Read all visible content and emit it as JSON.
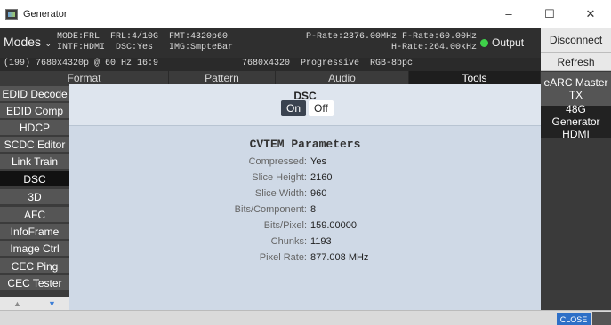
{
  "window": {
    "title": "Generator",
    "minimize": "–",
    "maximize": "☐",
    "close": "✕"
  },
  "status": {
    "modes_label": "Modes",
    "line1_left": "MODE:FRL  FRL:4/10G  FMT:4320p60",
    "line2_left": "INTF:HDMI  DSC:Yes   IMG:SmpteBar",
    "line1_right": "P-Rate:2376.00MHz F-Rate:60.00Hz",
    "line2_right": "H-Rate:264.00kHz",
    "line3_left": "(199) 7680x4320p @ 60 Hz 16:9",
    "line3_right": "7680x4320  Progressive  RGB-8bpc",
    "output_label": "Output",
    "output_color": "#3fd24a"
  },
  "right_buttons": {
    "disconnect": "Disconnect",
    "refresh": "Refresh",
    "earc": "eARC Master TX",
    "generator48": "48G Generator HDMI"
  },
  "tabs": [
    "Format",
    "Pattern",
    "Audio",
    "Tools"
  ],
  "active_tab": "Tools",
  "left_menu": [
    "EDID Decode",
    "EDID Comp",
    "HDCP",
    "SCDC Editor",
    "Link Train",
    "DSC",
    "3D",
    "AFC",
    "InfoFrame",
    "Image Ctrl",
    "CEC Ping",
    "CEC Tester"
  ],
  "left_menu_active": "DSC",
  "dsc": {
    "title": "DSC",
    "on_label": "On",
    "off_label": "Off"
  },
  "params": {
    "title": "CVTEM Parameters",
    "rows": [
      {
        "label": "Compressed:",
        "value": "Yes"
      },
      {
        "label": "Slice Height:",
        "value": "2160"
      },
      {
        "label": "Slice Width:",
        "value": "960"
      },
      {
        "label": "Bits/Component:",
        "value": "8"
      },
      {
        "label": "Bits/Pixel:",
        "value": "159.00000"
      },
      {
        "label": "Chunks:",
        "value": "1193"
      },
      {
        "label": "Pixel Rate:",
        "value": "877.008 MHz"
      }
    ]
  },
  "bottom": {
    "close_label": "CLOSE"
  },
  "colors": {
    "accent": "#2d6fc7",
    "content_bg": "#cfd9e6"
  }
}
